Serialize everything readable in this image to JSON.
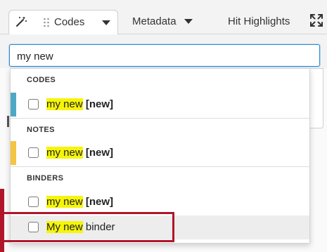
{
  "tabs": {
    "codes_label": "Codes",
    "metadata_label": "Metadata",
    "hits_label": "Hit Highlights"
  },
  "search": {
    "value": "my new"
  },
  "dropdown": {
    "sections": [
      {
        "header": "CODES",
        "color": "#4ea8c4",
        "items": [
          {
            "highlight": "my new",
            "rest": " [new]",
            "rest_bold": true
          }
        ]
      },
      {
        "header": "NOTES",
        "color": "#f4c543",
        "items": [
          {
            "highlight": "my new",
            "rest": " [new]",
            "rest_bold": true
          }
        ]
      },
      {
        "header": "BINDERS",
        "color": "#b0162a",
        "items": [
          {
            "highlight": "my new",
            "rest": " [new]",
            "rest_bold": true
          },
          {
            "highlight": "My new",
            "rest": " binder",
            "rest_bold": false
          }
        ]
      }
    ]
  },
  "colors": {
    "accent_blue": "#2b8ad8",
    "highlight_yellow": "#f5f50a",
    "annotation_red": "#b0162a"
  }
}
